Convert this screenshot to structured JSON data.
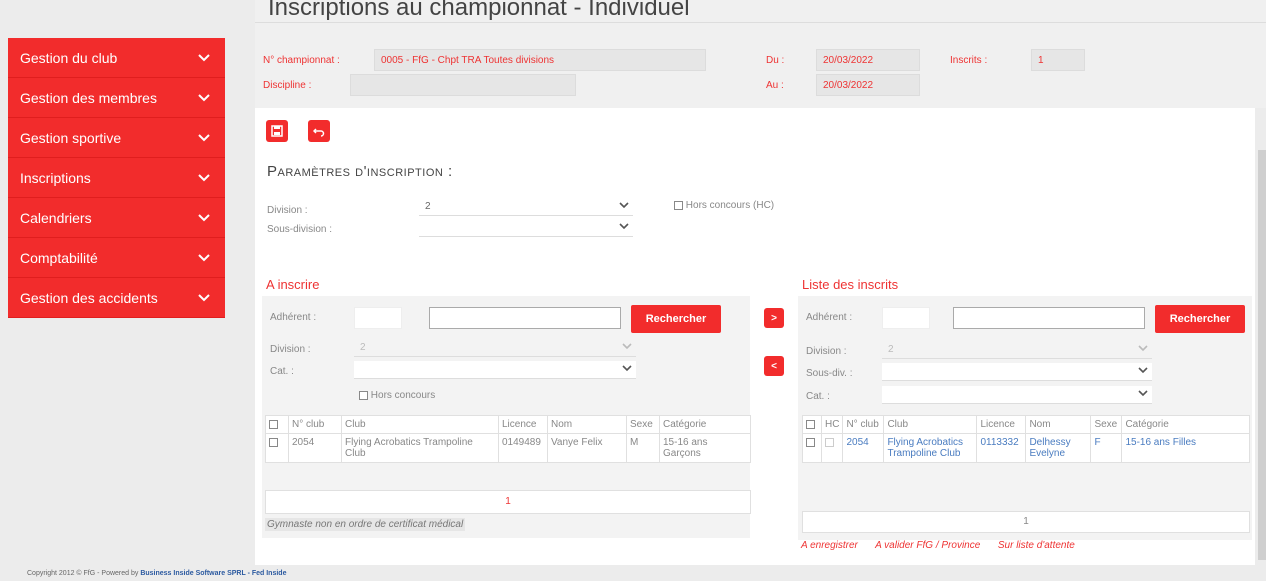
{
  "sidebar": {
    "items": [
      {
        "label": "Gestion du club"
      },
      {
        "label": "Gestion des membres"
      },
      {
        "label": "Gestion sportive"
      },
      {
        "label": "Inscriptions"
      },
      {
        "label": "Calendriers"
      },
      {
        "label": "Comptabilité"
      },
      {
        "label": "Gestion des accidents"
      }
    ]
  },
  "header": {
    "title": "Inscriptions au championnat - Individuel",
    "championnat_label": "N° championnat :",
    "championnat_value": "0005 - FfG - Chpt TRA Toutes divisions",
    "discipline_label": "Discipline :",
    "discipline_value": "",
    "du_label": "Du :",
    "du_value": "20/03/2022",
    "au_label": "Au :",
    "au_value": "20/03/2022",
    "inscrits_label": "Inscrits :",
    "inscrits_value": "1"
  },
  "params": {
    "title": "Paramètres d'inscription :",
    "division_label": "Division :",
    "division_value": "2",
    "sous_division_label": "Sous-division :",
    "sous_division_value": "",
    "hors_concours_label": "Hors concours (HC)"
  },
  "left": {
    "title": "A inscrire",
    "adherent_label": "Adhérent :",
    "division_label": "Division :",
    "division_value": "2",
    "cat_label": "Cat. :",
    "hors_concours_label": "Hors concours",
    "search_button": "Rechercher",
    "columns": [
      "N° club",
      "Club",
      "Licence",
      "Nom",
      "Sexe",
      "Catégorie"
    ],
    "rows": [
      {
        "club_no": "2054",
        "club": "Flying Acrobatics Trampoline Club",
        "licence": "0149489",
        "nom": "Vanye Felix",
        "sexe": "M",
        "categorie": "15-16 ans Garçons"
      }
    ],
    "page": "1",
    "note": "Gymnaste non en ordre de certificat médical"
  },
  "right": {
    "title": "Liste des inscrits",
    "adherent_label": "Adhérent :",
    "division_label": "Division :",
    "division_value": "2",
    "sous_div_label": "Sous-div. :",
    "cat_label": "Cat. :",
    "search_button": "Rechercher",
    "columns": [
      "HC",
      "N° club",
      "Club",
      "Licence",
      "Nom",
      "Sexe",
      "Catégorie"
    ],
    "rows": [
      {
        "club_no": "2054",
        "club": "Flying Acrobatics Trampoline Club",
        "licence": "0113332",
        "nom": "Delhessy Evelyne",
        "sexe": "F",
        "categorie": "15-16 ans Filles"
      }
    ],
    "page": "1",
    "links": [
      "A enregistrer",
      "A valider FfG / Province",
      "Sur liste d'attente"
    ]
  },
  "transfer": {
    "add": ">",
    "remove": "<"
  },
  "footer": {
    "copyright_prefix": "Copyright 2012 © FfG - Powered by",
    "company": "Business Inside Software SPRL - Fed Inside"
  },
  "colors": {
    "accent": "#f22c2c",
    "link": "#4a7cc0"
  },
  "icons": [
    "save-icon",
    "undo-icon",
    "chevron-down-icon"
  ]
}
